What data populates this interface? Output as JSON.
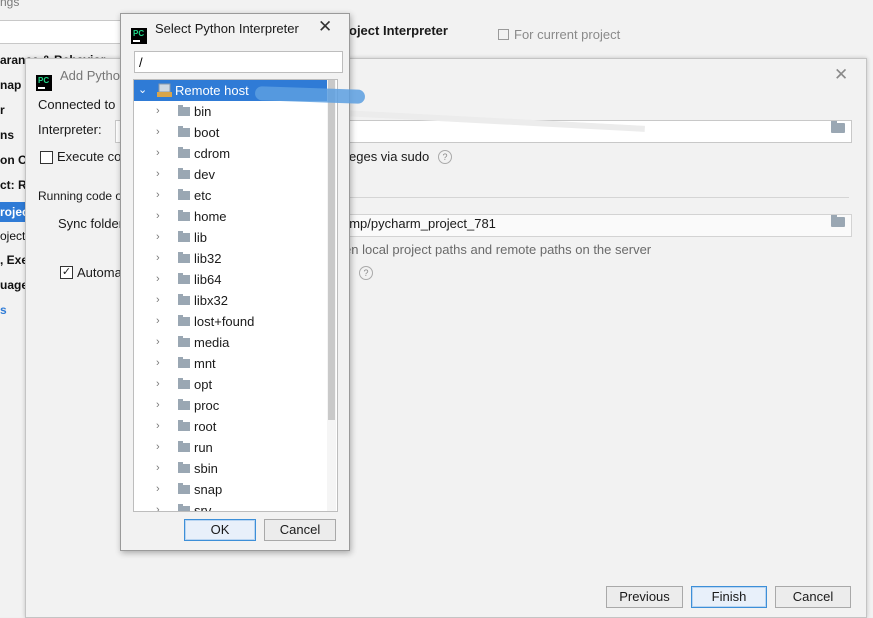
{
  "settings": {
    "title": "ngs",
    "header": "oject Interpreter",
    "for_current": "For current project",
    "sidebar": [
      {
        "label": "arance & Behavior"
      },
      {
        "label": "nap"
      },
      {
        "label": "r"
      },
      {
        "label": "ns"
      },
      {
        "label": "on C"
      },
      {
        "label": "ct: R"
      },
      {
        "label": "roject"
      },
      {
        "label": "oject"
      },
      {
        "label": ", Exe"
      },
      {
        "label": "uage"
      },
      {
        "label": "s"
      }
    ]
  },
  "add_dialog": {
    "title": "Add Pytho",
    "connected_label": "Connected to",
    "interpreter_label": "Interpreter:",
    "execute_label": "Execute co",
    "sudo_label": "eges via sudo",
    "running_label": "Running code o",
    "sync_label": "Sync folder",
    "sync_value": "/tmp/pycharm_project_781",
    "sync_hint": "en local project paths and remote paths on the server",
    "auto_label": "Automa",
    "auto_checked": true,
    "execute_checked": false,
    "buttons": {
      "previous": "Previous",
      "finish": "Finish",
      "cancel": "Cancel"
    }
  },
  "select_dialog": {
    "title": "Select Python Interpreter",
    "path_value": "/",
    "root_label": "Remote host",
    "folders": [
      "bin",
      "boot",
      "cdrom",
      "dev",
      "etc",
      "home",
      "lib",
      "lib32",
      "lib64",
      "libx32",
      "lost+found",
      "media",
      "mnt",
      "opt",
      "proc",
      "root",
      "run",
      "sbin",
      "snap",
      "srv"
    ],
    "buttons": {
      "ok": "OK",
      "cancel": "Cancel"
    }
  },
  "colors": {
    "selection": "#2f7bd6",
    "default_button_border": "#3d8fd8"
  },
  "icons": [
    "pycharm-logo-icon",
    "close-icon",
    "folder-icon",
    "help-icon",
    "chevron-right-icon",
    "chevron-down-icon",
    "remote-host-icon"
  ]
}
